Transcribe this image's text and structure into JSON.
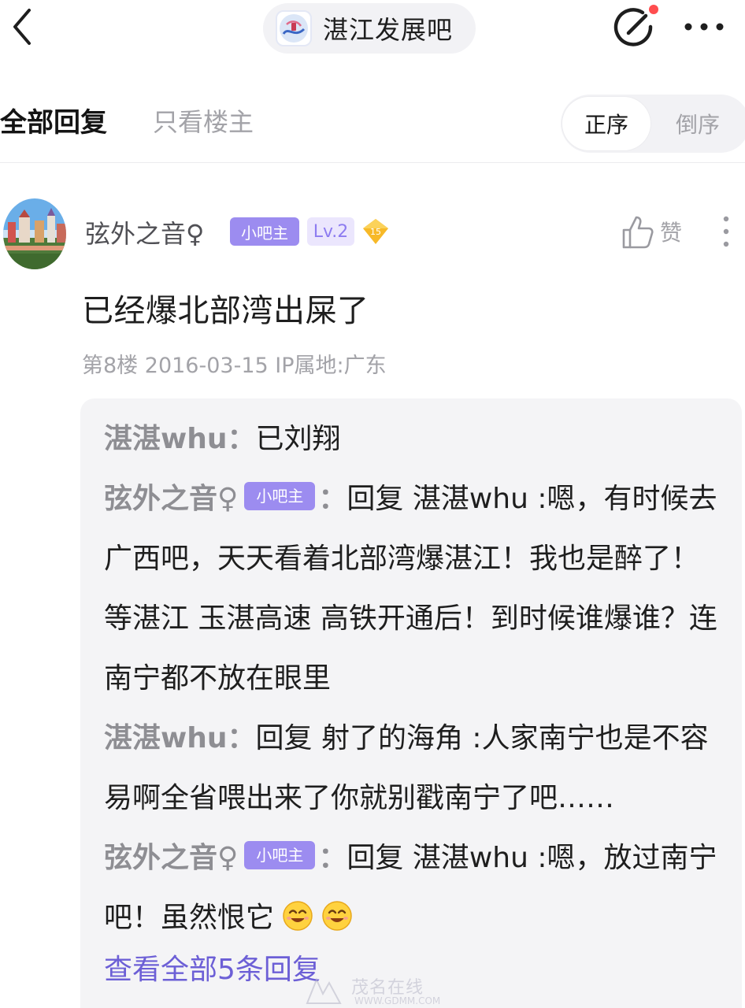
{
  "header": {
    "forum_name": "湛江发展吧",
    "back_icon": "chevron-left-icon",
    "edit_icon": "edit-post-icon",
    "more_icon": "more-horizontal-icon",
    "notify_dot_color": "#ff4d4f"
  },
  "filters": {
    "all_replies": "全部回复",
    "op_only": "只看楼主",
    "order_asc": "正序",
    "order_desc": "倒序",
    "selected_order": "正序"
  },
  "post": {
    "username": "弦外之音♀",
    "badge_manager": "小吧主",
    "badge_level": "Lv.2",
    "badge_gem_number": "15",
    "like_label": "赞",
    "content": "已经爆北部湾出屎了",
    "meta": "第8楼 2016-03-15 IP属地:广东"
  },
  "replies": {
    "items": [
      {
        "author": "湛湛whu",
        "badge": "",
        "sep": "：",
        "text": "已刘翔"
      },
      {
        "author": "弦外之音♀",
        "badge": "小吧主",
        "sep": "：",
        "text": "回复 湛湛whu :嗯，有时候去广西吧，天天看着北部湾爆湛江！我也是醉了！等湛江 玉湛高速 高铁开通后！到时候谁爆谁？连南宁都不放在眼里"
      },
      {
        "author": "湛湛whu",
        "badge": "",
        "sep": "：",
        "text": "回复 射了的海角 :人家南宁也是不容易啊全省喂出来了你就别戳南宁了吧……"
      },
      {
        "author": "弦外之音♀",
        "badge": "小吧主",
        "sep": "：",
        "text": "回复 湛湛whu :嗯，放过南宁吧！虽然恨它"
      }
    ],
    "view_all": "查看全部5条回复"
  },
  "watermark": {
    "brand": "茂名在线",
    "url": "WWW.GDMM.COM"
  },
  "colors": {
    "accent": "#9c8cf0",
    "link": "#6c5fd6",
    "muted": "#a3a3a8",
    "reply_bg": "#f4f4f6"
  }
}
